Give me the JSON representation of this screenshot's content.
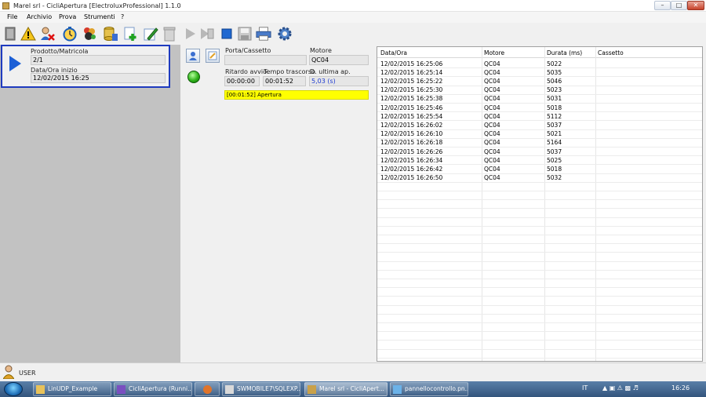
{
  "window": {
    "title": "Marel srl - CicliApertura [ElectroluxProfessional] 1.1.0"
  },
  "menu": [
    "File",
    "Archivio",
    "Prova",
    "Strumenti",
    "?"
  ],
  "toolbar": {
    "icons": [
      "exit-icon",
      "warning-icon",
      "user-delete-icon",
      "timer-icon",
      "group-icon",
      "database-icon",
      "add-icon",
      "edit-icon",
      "trash-icon",
      "play-icon",
      "skip-icon",
      "stop-icon",
      "save-icon",
      "print-icon",
      "settings-icon"
    ]
  },
  "run_panel": {
    "product_label": "Prodotto/Matricola",
    "product_value": "2/1",
    "start_label": "Data/Ora inizio",
    "start_value": "12/02/2015 16:25"
  },
  "status": {
    "door_label": "Porta/Cassetto",
    "door_value": "",
    "motor_label": "Motore",
    "motor_value": "QC04",
    "delay_label": "Ritardo avvio",
    "delay_value": "00:00:00",
    "elapsed_label": "Tempo trascorso",
    "elapsed_value": "00:01:52",
    "last_label": "D. ultima ap.",
    "last_value": "5,03 (s)",
    "log_text": "[00:01:52] Apertura",
    "led_color": "#2fb21a"
  },
  "table": {
    "columns": [
      "Data/Ora",
      "Motore",
      "Durata (ms)",
      "Cassetto"
    ],
    "rows": [
      [
        "12/02/2015 16:25:06",
        "QC04",
        "5022",
        ""
      ],
      [
        "12/02/2015 16:25:14",
        "QC04",
        "5035",
        ""
      ],
      [
        "12/02/2015 16:25:22",
        "QC04",
        "5046",
        ""
      ],
      [
        "12/02/2015 16:25:30",
        "QC04",
        "5023",
        ""
      ],
      [
        "12/02/2015 16:25:38",
        "QC04",
        "5031",
        ""
      ],
      [
        "12/02/2015 16:25:46",
        "QC04",
        "5018",
        ""
      ],
      [
        "12/02/2015 16:25:54",
        "QC04",
        "5112",
        ""
      ],
      [
        "12/02/2015 16:26:02",
        "QC04",
        "5037",
        ""
      ],
      [
        "12/02/2015 16:26:10",
        "QC04",
        "5021",
        ""
      ],
      [
        "12/02/2015 16:26:18",
        "QC04",
        "5164",
        ""
      ],
      [
        "12/02/2015 16:26:26",
        "QC04",
        "5037",
        ""
      ],
      [
        "12/02/2015 16:26:34",
        "QC04",
        "5025",
        ""
      ],
      [
        "12/02/2015 16:26:42",
        "QC04",
        "5018",
        ""
      ],
      [
        "12/02/2015 16:26:50",
        "QC04",
        "5032",
        ""
      ]
    ]
  },
  "user": {
    "label": "USER"
  },
  "taskbar": {
    "items": [
      "LinUDP_Example",
      "CicliApertura (Runni...",
      "",
      "SWMOBILE7\\SQLEXP...",
      "Marel srl - CicliApert...",
      "pannellocontrollo.pn..."
    ],
    "lang": "IT",
    "clock": "16:26"
  }
}
